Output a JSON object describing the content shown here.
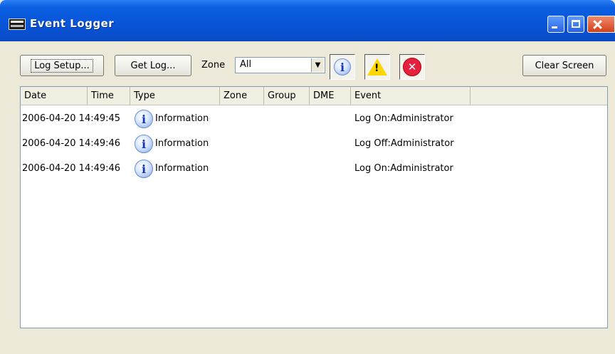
{
  "window": {
    "title": "Event Logger",
    "app_icon": "dme-icon"
  },
  "toolbar": {
    "log_setup_label": "Log Setup...",
    "get_log_label": "Get Log...",
    "zone_label": "Zone",
    "zone_value": "All",
    "filter_info_icon": "info-icon",
    "filter_warning_icon": "warning-icon",
    "filter_error_icon": "error-icon",
    "clear_screen_label": "Clear Screen"
  },
  "table": {
    "columns": [
      "Date",
      "Time",
      "Type",
      "Zone",
      "Group",
      "DME",
      "Event"
    ],
    "rows": [
      {
        "datetime": "2006-04-20 14:49:45",
        "type": "Information",
        "event": "Log On:Administrator"
      },
      {
        "datetime": "2006-04-20 14:49:46",
        "type": "Information",
        "event": "Log Off:Administrator"
      },
      {
        "datetime": "2006-04-20 14:49:46",
        "type": "Information",
        "event": "Log On:Administrator"
      }
    ]
  }
}
